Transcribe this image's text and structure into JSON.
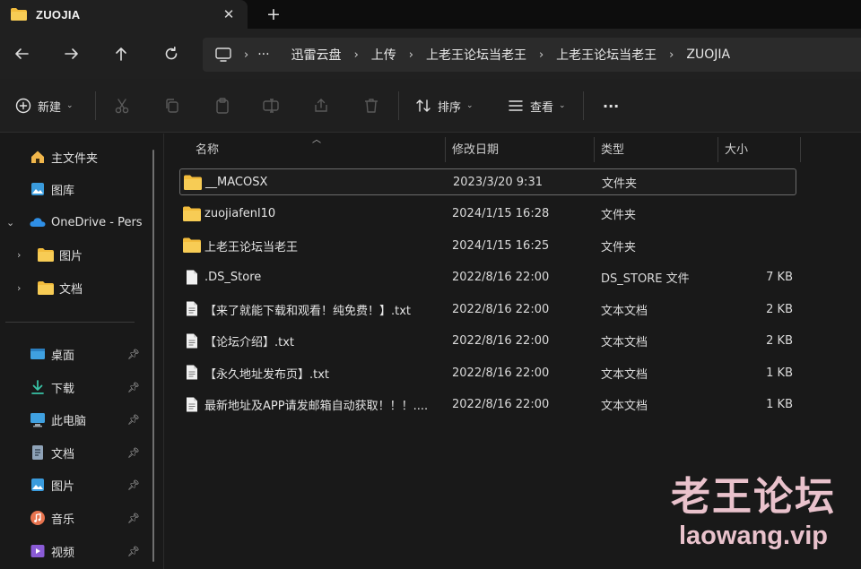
{
  "window": {
    "tab_title": "ZUOJIA",
    "close_symbol": "✕",
    "new_tab_symbol": "+"
  },
  "address": {
    "overflow": "···",
    "crumbs": [
      "迅雷云盘",
      "上传",
      "上老王论坛当老王",
      "上老王论坛当老王",
      "ZUOJIA"
    ]
  },
  "toolbar": {
    "new_label": "新建",
    "sort_label": "排序",
    "view_label": "查看",
    "more_label": "···"
  },
  "sidebar": {
    "top": [
      {
        "label": "主文件夹",
        "icon": "home-icon"
      },
      {
        "label": "图库",
        "icon": "gallery-icon"
      },
      {
        "label": "OneDrive - Pers",
        "icon": "onedrive-icon"
      },
      {
        "label": "图片",
        "icon": "folder-icon"
      },
      {
        "label": "文档",
        "icon": "folder-icon"
      }
    ],
    "pinned": [
      {
        "label": "桌面",
        "icon": "desktop-icon"
      },
      {
        "label": "下载",
        "icon": "download-icon"
      },
      {
        "label": "此电脑",
        "icon": "pc-icon"
      },
      {
        "label": "文档",
        "icon": "document-icon"
      },
      {
        "label": "图片",
        "icon": "picture-icon"
      },
      {
        "label": "音乐",
        "icon": "music-icon"
      },
      {
        "label": "视频",
        "icon": "video-icon"
      }
    ]
  },
  "columns": {
    "name": "名称",
    "modified": "修改日期",
    "type": "类型",
    "size": "大小"
  },
  "files": [
    {
      "name": "__MACOSX",
      "modified": "2023/3/20 9:31",
      "type": "文件夹",
      "size": "",
      "kind": "folder"
    },
    {
      "name": "zuojiafenl10",
      "modified": "2024/1/15 16:28",
      "type": "文件夹",
      "size": "",
      "kind": "folder"
    },
    {
      "name": "上老王论坛当老王",
      "modified": "2024/1/15 16:25",
      "type": "文件夹",
      "size": "",
      "kind": "folder"
    },
    {
      "name": ".DS_Store",
      "modified": "2022/8/16 22:00",
      "type": "DS_STORE 文件",
      "size": "7 KB",
      "kind": "file"
    },
    {
      "name": "【来了就能下载和观看！纯免费！】.txt",
      "modified": "2022/8/16 22:00",
      "type": "文本文档",
      "size": "2 KB",
      "kind": "text"
    },
    {
      "name": "【论坛介绍】.txt",
      "modified": "2022/8/16 22:00",
      "type": "文本文档",
      "size": "2 KB",
      "kind": "text"
    },
    {
      "name": "【永久地址发布页】.txt",
      "modified": "2022/8/16 22:00",
      "type": "文本文档",
      "size": "1 KB",
      "kind": "text"
    },
    {
      "name": "最新地址及APP请发邮箱自动获取！！！....",
      "modified": "2022/8/16 22:00",
      "type": "文本文档",
      "size": "1 KB",
      "kind": "text"
    }
  ],
  "watermark": {
    "title": "老王论坛",
    "url": "laowang.vip"
  },
  "colors": {
    "folder": "#f2bc3c",
    "accent_blue": "#3a9bdc",
    "watermark": "#e9c2cc"
  }
}
